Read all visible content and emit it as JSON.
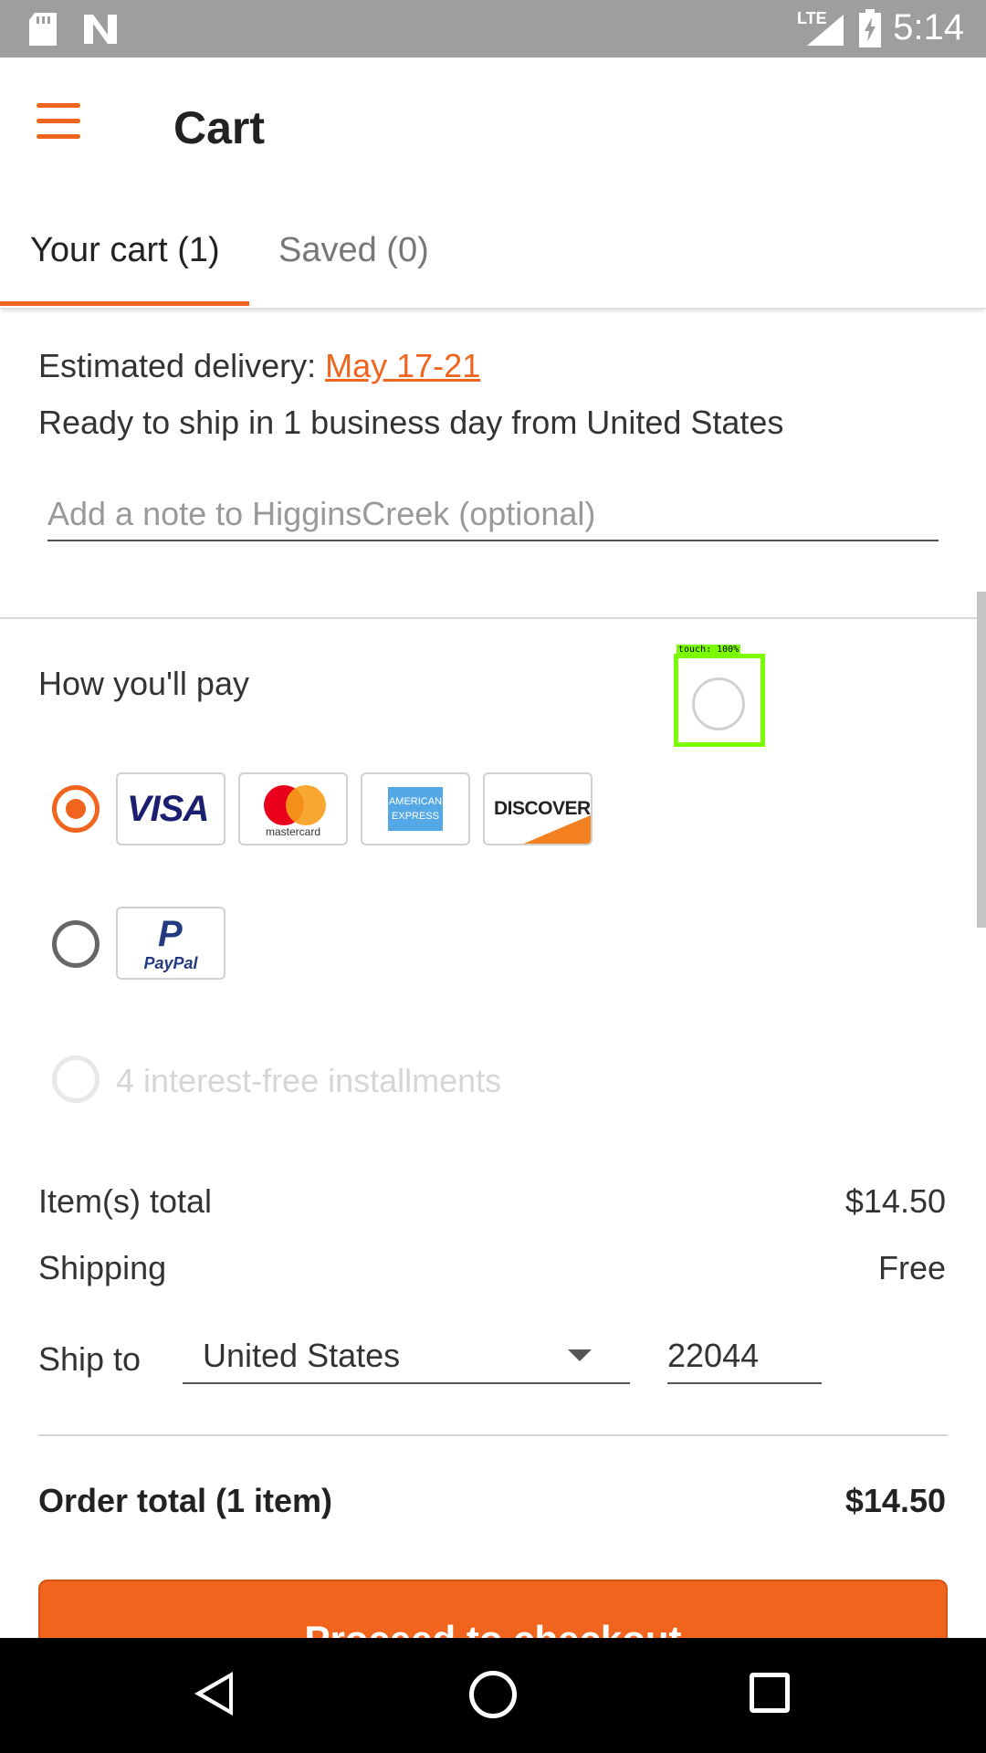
{
  "status_bar": {
    "time": "5:14",
    "network": "LTE"
  },
  "app_bar": {
    "title": "Cart"
  },
  "tabs": [
    {
      "label": "Your cart (1)",
      "active": true
    },
    {
      "label": "Saved (0)",
      "active": false
    }
  ],
  "delivery": {
    "prefix": "Estimated delivery: ",
    "date": "May 17-21",
    "ship_ready": "Ready to ship in 1 business day from United States",
    "note_placeholder": "Add a note to HigginsCreek (optional)"
  },
  "payment": {
    "title": "How you'll pay",
    "options": [
      {
        "id": "cards",
        "selected": true,
        "cards": [
          "visa-icon",
          "mastercard-icon",
          "amex-icon",
          "discover-icon"
        ]
      },
      {
        "id": "paypal",
        "selected": false,
        "cards": [
          "paypal-icon"
        ]
      },
      {
        "id": "installments",
        "selected": false,
        "disabled": true,
        "label": "4 interest-free installments"
      }
    ],
    "card_labels": {
      "visa": "VISA",
      "mastercard": "mastercard",
      "amex": "AMERICAN EXPRESS",
      "discover": "DISCOVER",
      "paypal_mark": "P",
      "paypal": "PayPal"
    },
    "touch_overlay": "touch: 100%"
  },
  "totals": {
    "items_label": "Item(s) total",
    "items_value": "$14.50",
    "shipping_label": "Shipping",
    "shipping_value": "Free",
    "ship_to_label": "Ship to",
    "country": "United States",
    "zip": "22044",
    "order_label": "Order total (1 item)",
    "order_value": "$14.50"
  },
  "checkout": {
    "label": "Proceed to checkout"
  },
  "colors": {
    "accent": "#f1641e",
    "status_bar": "#9e9e9e",
    "nav_bar": "#000000"
  }
}
